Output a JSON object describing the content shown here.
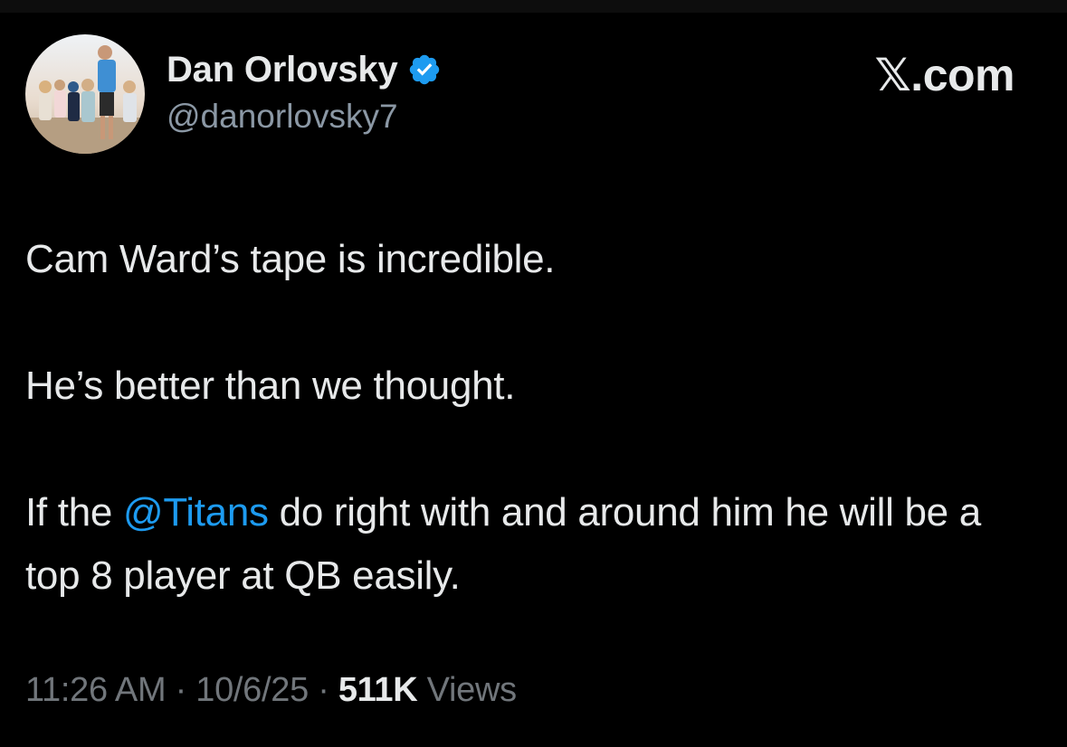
{
  "author": {
    "display_name": "Dan Orlovsky",
    "handle": "@danorlovsky7",
    "verified": true,
    "avatar_icon": "profile-photo"
  },
  "brand": {
    "label": "𝕏.com"
  },
  "tweet": {
    "lines": [
      "Cam Ward’s tape is incredible.",
      "He’s better than we thought."
    ],
    "third_paragraph": {
      "before": "If the ",
      "mention": "@Titans",
      "after": " do right with and around him he will be a top 8 player at QB easily."
    }
  },
  "meta": {
    "time": "11:26 AM",
    "separator": "·",
    "date": "10/6/25",
    "views_count": "511K",
    "views_label": "Views"
  },
  "colors": {
    "background": "#000000",
    "text": "#e7e9ea",
    "secondary_text": "#71767b",
    "accent": "#1d9bf0"
  }
}
